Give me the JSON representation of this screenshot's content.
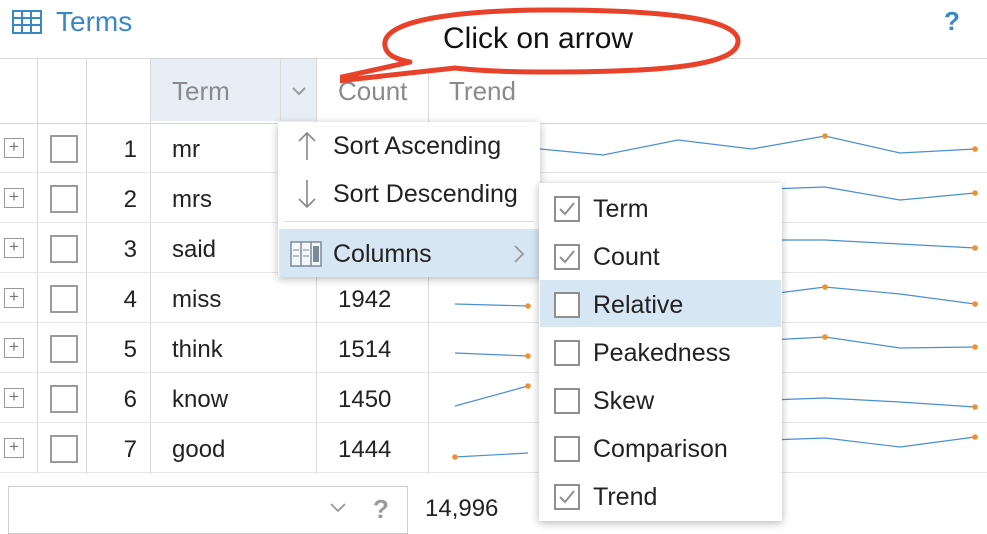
{
  "panel": {
    "title": "Terms",
    "help": "?"
  },
  "callout": {
    "text": "Click on arrow"
  },
  "columns": {
    "term": "Term",
    "count": "Count",
    "trend": "Trend"
  },
  "rows": [
    {
      "index": "1",
      "term": "mr",
      "count": ""
    },
    {
      "index": "2",
      "term": "mrs",
      "count": ""
    },
    {
      "index": "3",
      "term": "said",
      "count": ""
    },
    {
      "index": "4",
      "term": "miss",
      "count": "1942"
    },
    {
      "index": "5",
      "term": "think",
      "count": "1514"
    },
    {
      "index": "6",
      "term": "know",
      "count": "1450"
    },
    {
      "index": "7",
      "term": "good",
      "count": "1444"
    }
  ],
  "column_menu": {
    "sort_asc": "Sort Ascending",
    "sort_desc": "Sort Descending",
    "columns": "Columns"
  },
  "columns_submenu": [
    {
      "label": "Term",
      "checked": true
    },
    {
      "label": "Count",
      "checked": true
    },
    {
      "label": "Relative",
      "checked": false,
      "highlighted": true
    },
    {
      "label": "Peakedness",
      "checked": false
    },
    {
      "label": "Skew",
      "checked": false
    },
    {
      "label": "Comparison",
      "checked": false
    },
    {
      "label": "Trend",
      "checked": true
    }
  ],
  "footer": {
    "help": "?",
    "total": "14,996"
  },
  "colors": {
    "accent": "#3a87c8",
    "callout_border": "#e8432a",
    "trend_line": "#4a8fd4",
    "trend_dot": "#f0922c",
    "highlight": "#d6e6f3"
  }
}
